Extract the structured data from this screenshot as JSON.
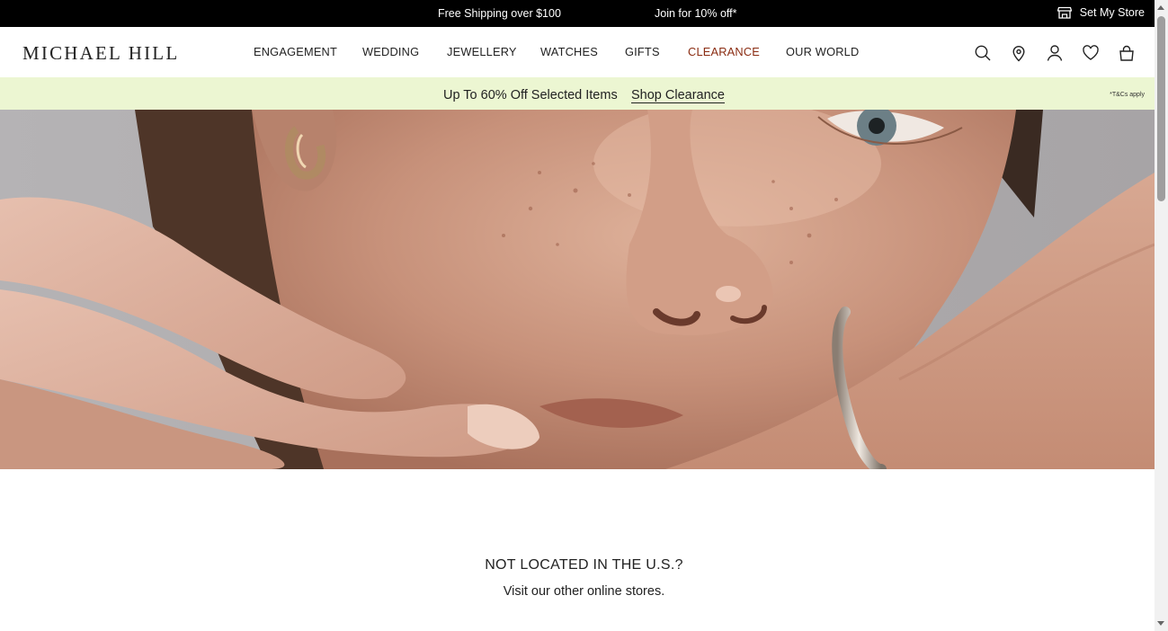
{
  "announcement": {
    "shipping": "Free Shipping over $100",
    "join": "Join for 10% off*",
    "store_label": "Set My Store",
    "store_icon": "store-icon"
  },
  "header": {
    "logo": "MICHAEL HILL",
    "nav": [
      "ENGAGEMENT",
      "WEDDING",
      "JEWELLERY",
      "WATCHES",
      "GIFTS",
      "CLEARANCE",
      "OUR WORLD"
    ],
    "icons": [
      "search-icon",
      "location-pin-icon",
      "account-icon",
      "wishlist-heart-icon",
      "shopping-bag-icon"
    ],
    "clearance_color": "#8a2c12"
  },
  "promo": {
    "text": "Up To 60% Off Selected Items",
    "link": "Shop Clearance",
    "terms": "*T&Cs apply",
    "background": "#ecf6d2"
  },
  "hero": {
    "image": "close-up portrait of a woman with freckles resting her chin on her hand, wearing gold hoop earring and silver cuff bangle"
  },
  "locate": {
    "heading": "NOT LOCATED IN THE U.S.?",
    "subheading": "Visit our other online stores."
  }
}
